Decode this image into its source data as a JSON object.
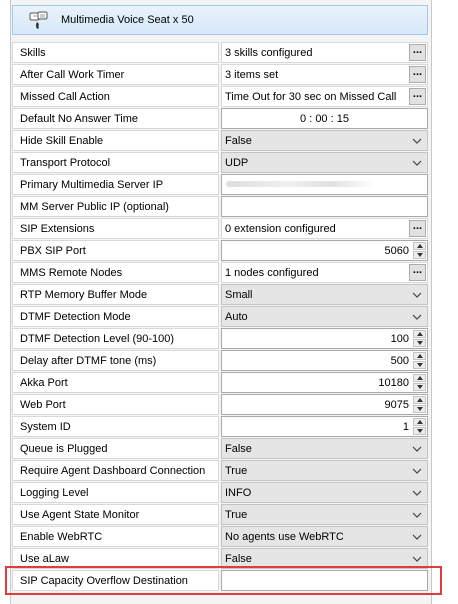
{
  "header": {
    "title": "Multimedia Voice Seat x 50"
  },
  "highlight_color": "#e03c3c",
  "rows": [
    {
      "label": "Skills",
      "type": "dots",
      "value": "3 skills configured"
    },
    {
      "label": "After Call Work Timer",
      "type": "dots",
      "value": "3 items set"
    },
    {
      "label": "Missed Call Action",
      "type": "dots",
      "value": "Time Out for 30 sec on Missed Call"
    },
    {
      "label": "Default No Answer Time",
      "type": "time",
      "value": "0 : 00 : 15"
    },
    {
      "label": "Hide Skill Enable",
      "type": "combo",
      "value": "False"
    },
    {
      "label": "Transport Protocol",
      "type": "combo",
      "value": "UDP"
    },
    {
      "label": "Primary Multimedia Server IP",
      "type": "redacted",
      "value": ""
    },
    {
      "label": "MM Server Public IP (optional)",
      "type": "input",
      "value": ""
    },
    {
      "label": "SIP Extensions",
      "type": "dots",
      "value": "0 extension configured"
    },
    {
      "label": "PBX SIP Port",
      "type": "spin",
      "value": "5060"
    },
    {
      "label": "MMS Remote Nodes",
      "type": "dots",
      "value": "1 nodes configured"
    },
    {
      "label": "RTP Memory Buffer Mode",
      "type": "combo",
      "value": "Small"
    },
    {
      "label": "DTMF Detection Mode",
      "type": "combo",
      "value": "Auto"
    },
    {
      "label": "DTMF Detection Level (90-100)",
      "type": "spin",
      "value": "100"
    },
    {
      "label": "Delay after DTMF tone (ms)",
      "type": "spin",
      "value": "500"
    },
    {
      "label": "Akka Port",
      "type": "spin",
      "value": "10180"
    },
    {
      "label": "Web Port",
      "type": "spin",
      "value": "9075"
    },
    {
      "label": "System ID",
      "type": "spin",
      "value": "1"
    },
    {
      "label": "Queue is Plugged",
      "type": "combo",
      "value": "False"
    },
    {
      "label": "Require Agent Dashboard Connection",
      "type": "combo",
      "value": "True"
    },
    {
      "label": "Logging Level",
      "type": "combo",
      "value": "INFO"
    },
    {
      "label": "Use Agent State Monitor",
      "type": "combo",
      "value": "True"
    },
    {
      "label": "Enable WebRTC",
      "type": "combo",
      "value": "No agents use WebRTC"
    },
    {
      "label": "Use aLaw",
      "type": "combo",
      "value": "False"
    },
    {
      "label": "SIP Capacity Overflow Destination",
      "type": "input",
      "value": ""
    }
  ],
  "icons": {
    "header": "chat-phone-icon",
    "dots": "ellipsis-icon",
    "combo": "chevron-down-icon"
  }
}
